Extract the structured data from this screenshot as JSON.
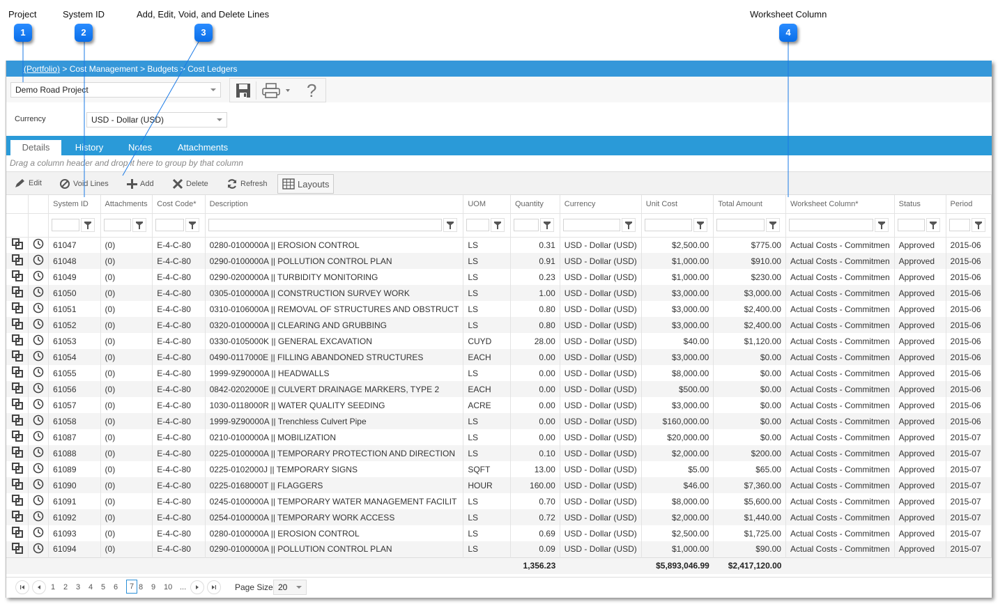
{
  "callouts": [
    {
      "number": "1",
      "label": "Project"
    },
    {
      "number": "2",
      "label": "System ID"
    },
    {
      "number": "3",
      "label": "Add, Edit, Void, and Delete Lines"
    },
    {
      "number": "4",
      "label": "Worksheet Column"
    }
  ],
  "breadcrumb": {
    "link": "(Portfolio)",
    "rest": " > Cost Management > Budgets > Cost Ledgers"
  },
  "project_select": {
    "value": "Demo Road Project"
  },
  "toolbar": {
    "save_icon": "save-icon",
    "print_icon": "printer-icon",
    "help_label": "?"
  },
  "currency": {
    "label": "Currency",
    "value": "USD - Dollar (USD)"
  },
  "tabs": [
    {
      "label": "Details",
      "active": true
    },
    {
      "label": "History",
      "active": false
    },
    {
      "label": "Notes",
      "active": false
    },
    {
      "label": "Attachments",
      "active": false
    }
  ],
  "grouping_hint": "Drag a column header and drop it here to group by that column",
  "actions": {
    "edit": "Edit",
    "void": "Void Lines",
    "add": "Add",
    "delete": "Delete",
    "refresh": "Refresh",
    "layouts": "Layouts"
  },
  "columns": [
    "",
    "",
    "System ID",
    "Attachments",
    "Cost Code*",
    "Description",
    "UOM",
    "Quantity",
    "Currency",
    "Unit Cost",
    "Total Amount",
    "Worksheet Column*",
    "Status",
    "Period"
  ],
  "rows": [
    {
      "id": "61047",
      "att": "(0)",
      "code": "E-4-C-80",
      "desc": "0280-0100000A || EROSION CONTROL",
      "uom": "LS",
      "qty": "0.31",
      "cur": "USD - Dollar (USD)",
      "unit": "$2,500.00",
      "total": "$775.00",
      "ws": "Actual Costs - Commitmen",
      "status": "Approved",
      "period": "2015-06"
    },
    {
      "id": "61048",
      "att": "(0)",
      "code": "E-4-C-80",
      "desc": "0290-0100000A || POLLUTION CONTROL PLAN",
      "uom": "LS",
      "qty": "0.91",
      "cur": "USD - Dollar (USD)",
      "unit": "$1,000.00",
      "total": "$910.00",
      "ws": "Actual Costs - Commitmen",
      "status": "Approved",
      "period": "2015-06"
    },
    {
      "id": "61049",
      "att": "(0)",
      "code": "E-4-C-80",
      "desc": "0290-0200000A || TURBIDITY MONITORING",
      "uom": "LS",
      "qty": "0.23",
      "cur": "USD - Dollar (USD)",
      "unit": "$1,000.00",
      "total": "$230.00",
      "ws": "Actual Costs - Commitmen",
      "status": "Approved",
      "period": "2015-06"
    },
    {
      "id": "61050",
      "att": "(0)",
      "code": "E-4-C-80",
      "desc": "0305-0100000A || CONSTRUCTION SURVEY WORK",
      "uom": "LS",
      "qty": "1.00",
      "cur": "USD - Dollar (USD)",
      "unit": "$3,000.00",
      "total": "$3,000.00",
      "ws": "Actual Costs - Commitmen",
      "status": "Approved",
      "period": "2015-06"
    },
    {
      "id": "61051",
      "att": "(0)",
      "code": "E-4-C-80",
      "desc": "0310-0106000A || REMOVAL OF STRUCTURES AND OBSTRUCT",
      "uom": "LS",
      "qty": "0.80",
      "cur": "USD - Dollar (USD)",
      "unit": "$3,000.00",
      "total": "$2,400.00",
      "ws": "Actual Costs - Commitmen",
      "status": "Approved",
      "period": "2015-06"
    },
    {
      "id": "61052",
      "att": "(0)",
      "code": "E-4-C-80",
      "desc": "0320-0100000A || CLEARING AND GRUBBING",
      "uom": "LS",
      "qty": "0.80",
      "cur": "USD - Dollar (USD)",
      "unit": "$3,000.00",
      "total": "$2,400.00",
      "ws": "Actual Costs - Commitmen",
      "status": "Approved",
      "period": "2015-06"
    },
    {
      "id": "61053",
      "att": "(0)",
      "code": "E-4-C-80",
      "desc": "0330-0105000K || GENERAL EXCAVATION",
      "uom": "CUYD",
      "qty": "28.00",
      "cur": "USD - Dollar (USD)",
      "unit": "$40.00",
      "total": "$1,120.00",
      "ws": "Actual Costs - Commitmen",
      "status": "Approved",
      "period": "2015-06"
    },
    {
      "id": "61054",
      "att": "(0)",
      "code": "E-4-C-80",
      "desc": "0490-0117000E || FILLING ABANDONED STRUCTURES",
      "uom": "EACH",
      "qty": "0.00",
      "cur": "USD - Dollar (USD)",
      "unit": "$3,000.00",
      "total": "$0.00",
      "ws": "Actual Costs - Commitmen",
      "status": "Approved",
      "period": "2015-06"
    },
    {
      "id": "61055",
      "att": "(0)",
      "code": "E-4-C-80",
      "desc": "1999-9Z90000A || HEADWALLS",
      "uom": "LS",
      "qty": "0.00",
      "cur": "USD - Dollar (USD)",
      "unit": "$8,000.00",
      "total": "$0.00",
      "ws": "Actual Costs - Commitmen",
      "status": "Approved",
      "period": "2015-06"
    },
    {
      "id": "61056",
      "att": "(0)",
      "code": "E-4-C-80",
      "desc": "0842-0202000E || CULVERT DRAINAGE MARKERS, TYPE 2",
      "uom": "EACH",
      "qty": "0.00",
      "cur": "USD - Dollar (USD)",
      "unit": "$500.00",
      "total": "$0.00",
      "ws": "Actual Costs - Commitmen",
      "status": "Approved",
      "period": "2015-06"
    },
    {
      "id": "61057",
      "att": "(0)",
      "code": "E-4-C-80",
      "desc": "1030-0118000R || WATER QUALITY SEEDING",
      "uom": "ACRE",
      "qty": "0.00",
      "cur": "USD - Dollar (USD)",
      "unit": "$3,000.00",
      "total": "$0.00",
      "ws": "Actual Costs - Commitmen",
      "status": "Approved",
      "period": "2015-06"
    },
    {
      "id": "61058",
      "att": "(0)",
      "code": "E-4-C-80",
      "desc": "1999-9Z90000A || Trenchless Culvert Pipe",
      "uom": "LS",
      "qty": "0.00",
      "cur": "USD - Dollar (USD)",
      "unit": "$160,000.00",
      "total": "$0.00",
      "ws": "Actual Costs - Commitmen",
      "status": "Approved",
      "period": "2015-06"
    },
    {
      "id": "61087",
      "att": "(0)",
      "code": "E-4-C-80",
      "desc": "0210-0100000A || MOBILIZATION",
      "uom": "LS",
      "qty": "0.00",
      "cur": "USD - Dollar (USD)",
      "unit": "$20,000.00",
      "total": "$0.00",
      "ws": "Actual Costs - Commitmen",
      "status": "Approved",
      "period": "2015-07"
    },
    {
      "id": "61088",
      "att": "(0)",
      "code": "E-4-C-80",
      "desc": "0225-0100000A || TEMPORARY PROTECTION AND DIRECTION",
      "uom": "LS",
      "qty": "0.10",
      "cur": "USD - Dollar (USD)",
      "unit": "$2,000.00",
      "total": "$200.00",
      "ws": "Actual Costs - Commitmen",
      "status": "Approved",
      "period": "2015-07"
    },
    {
      "id": "61089",
      "att": "(0)",
      "code": "E-4-C-80",
      "desc": "0225-0102000J || TEMPORARY SIGNS",
      "uom": "SQFT",
      "qty": "13.00",
      "cur": "USD - Dollar (USD)",
      "unit": "$5.00",
      "total": "$65.00",
      "ws": "Actual Costs - Commitmen",
      "status": "Approved",
      "period": "2015-07"
    },
    {
      "id": "61090",
      "att": "(0)",
      "code": "E-4-C-80",
      "desc": "0225-0168000T || FLAGGERS",
      "uom": "HOUR",
      "qty": "160.00",
      "cur": "USD - Dollar (USD)",
      "unit": "$46.00",
      "total": "$7,360.00",
      "ws": "Actual Costs - Commitmen",
      "status": "Approved",
      "period": "2015-07"
    },
    {
      "id": "61091",
      "att": "(0)",
      "code": "E-4-C-80",
      "desc": "0245-0100000A || TEMPORARY WATER MANAGEMENT FACILIT",
      "uom": "LS",
      "qty": "0.70",
      "cur": "USD - Dollar (USD)",
      "unit": "$8,000.00",
      "total": "$5,600.00",
      "ws": "Actual Costs - Commitmen",
      "status": "Approved",
      "period": "2015-07"
    },
    {
      "id": "61092",
      "att": "(0)",
      "code": "E-4-C-80",
      "desc": "0254-0100000A || TEMPORARY WORK ACCESS",
      "uom": "LS",
      "qty": "0.72",
      "cur": "USD - Dollar (USD)",
      "unit": "$2,000.00",
      "total": "$1,440.00",
      "ws": "Actual Costs - Commitmen",
      "status": "Approved",
      "period": "2015-07"
    },
    {
      "id": "61093",
      "att": "(0)",
      "code": "E-4-C-80",
      "desc": "0280-0100000A || EROSION CONTROL",
      "uom": "LS",
      "qty": "0.69",
      "cur": "USD - Dollar (USD)",
      "unit": "$2,500.00",
      "total": "$1,725.00",
      "ws": "Actual Costs - Commitmen",
      "status": "Approved",
      "period": "2015-07"
    },
    {
      "id": "61094",
      "att": "(0)",
      "code": "E-4-C-80",
      "desc": "0290-0100000A || POLLUTION CONTROL PLAN",
      "uom": "LS",
      "qty": "0.09",
      "cur": "USD - Dollar (USD)",
      "unit": "$1,000.00",
      "total": "$90.00",
      "ws": "Actual Costs - Commitmen",
      "status": "Approved",
      "period": "2015-07"
    }
  ],
  "totals": {
    "quantity": "1,356.23",
    "unit_cost": "$5,893,046.99",
    "total_amount": "$2,417,120.00"
  },
  "pager": {
    "pages": [
      "1",
      "2",
      "3",
      "4",
      "5",
      "6",
      "7",
      "8",
      "9",
      "10",
      "..."
    ],
    "current": "7",
    "page_size_label": "Page Size",
    "page_size": "20"
  },
  "colors": {
    "accent": "#2a9ad8",
    "breadcrumb_bar": "#3597d9",
    "link": "#2f3fbb",
    "callout": "#0a6ee8"
  }
}
